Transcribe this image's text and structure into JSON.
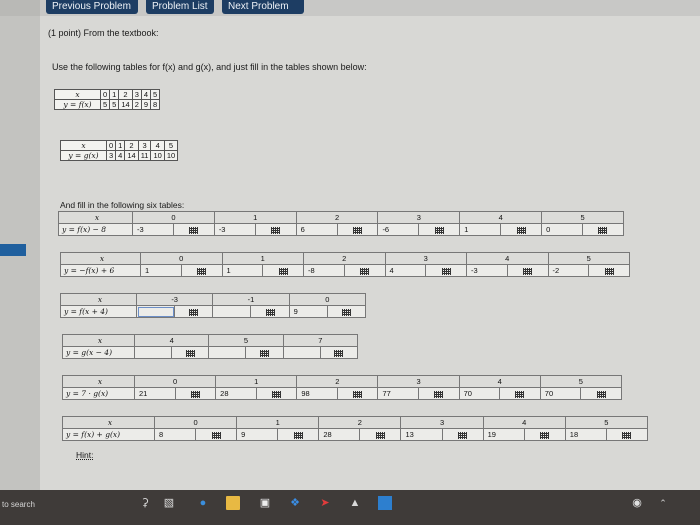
{
  "nav": {
    "prev": "Previous Problem",
    "list": "Problem List",
    "next": "Next Problem"
  },
  "problem": {
    "points": "(1 point) From the textbook:",
    "instructions": "Use the following tables for f(x) and g(x), and just fill in the tables shown below:",
    "fill_six": "And fill in the following six tables:",
    "hint": "Hint:"
  },
  "given": {
    "f": {
      "xlabel": "x",
      "ylabel": "y = f(x)",
      "x": [
        "0",
        "1",
        "2",
        "3",
        "4",
        "5"
      ],
      "y": [
        "5",
        "5",
        "14",
        "2",
        "9",
        "8"
      ]
    },
    "g": {
      "xlabel": "x",
      "ylabel": "y = g(x)",
      "x": [
        "0",
        "1",
        "2",
        "3",
        "4",
        "5"
      ],
      "y": [
        "3",
        "4",
        "14",
        "11",
        "10",
        "10"
      ]
    }
  },
  "answer_tables": [
    {
      "xlabel": "x",
      "ylabel": "y = f(x) − 8",
      "x": [
        "0",
        "1",
        "2",
        "3",
        "4",
        "5"
      ],
      "y": [
        "-3",
        "-3",
        "6",
        "-6",
        "1",
        "0"
      ]
    },
    {
      "xlabel": "x",
      "ylabel": "y = −f(x) + 6",
      "x": [
        "0",
        "1",
        "2",
        "3",
        "4",
        "5"
      ],
      "y": [
        "1",
        "1",
        "-8",
        "4",
        "-3",
        "-2"
      ]
    },
    {
      "xlabel": "x",
      "ylabel": "y = f(x + 4)",
      "x": [
        "-3",
        "-1",
        "0"
      ],
      "y": [
        "",
        "",
        "9"
      ]
    },
    {
      "xlabel": "x",
      "ylabel": "y = g(x − 4)",
      "x": [
        "4",
        "5",
        "7"
      ],
      "y": [
        "",
        "",
        ""
      ]
    },
    {
      "xlabel": "x",
      "ylabel": "y = 7 · g(x)",
      "x": [
        "0",
        "1",
        "2",
        "3",
        "4",
        "5"
      ],
      "y": [
        "21",
        "28",
        "98",
        "77",
        "70",
        "70"
      ]
    },
    {
      "xlabel": "x",
      "ylabel": "y = f(x) + g(x)",
      "x": [
        "0",
        "1",
        "2",
        "3",
        "4",
        "5"
      ],
      "y": [
        "8",
        "9",
        "28",
        "13",
        "19",
        "18"
      ]
    }
  ],
  "taskbar": {
    "search": "to search"
  },
  "colors": {
    "nav_button": "#1d3d63",
    "panel": "#d8d8d5",
    "taskbar": "#3f3b39"
  }
}
